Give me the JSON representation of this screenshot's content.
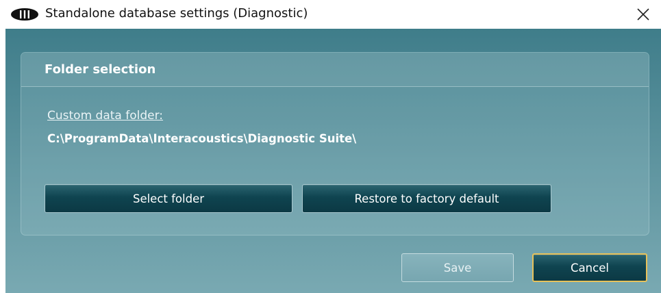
{
  "window": {
    "title": "Standalone database settings (Diagnostic)",
    "close_icon": "close-icon",
    "app_icon": "ear-device-icon"
  },
  "panel": {
    "title": "Folder selection",
    "folder_label": "Custom data folder:",
    "folder_path": "C:\\ProgramData\\Interacoustics\\Diagnostic Suite\\",
    "select_folder_label": "Select folder",
    "restore_label": "Restore to factory default"
  },
  "footer": {
    "save_label": "Save",
    "save_enabled": false,
    "cancel_label": "Cancel"
  },
  "colors": {
    "accent_focus": "#e8c25a",
    "button_dark": "#0f4450",
    "background_top": "#3f7d8a",
    "background_bottom": "#79a9b2"
  }
}
